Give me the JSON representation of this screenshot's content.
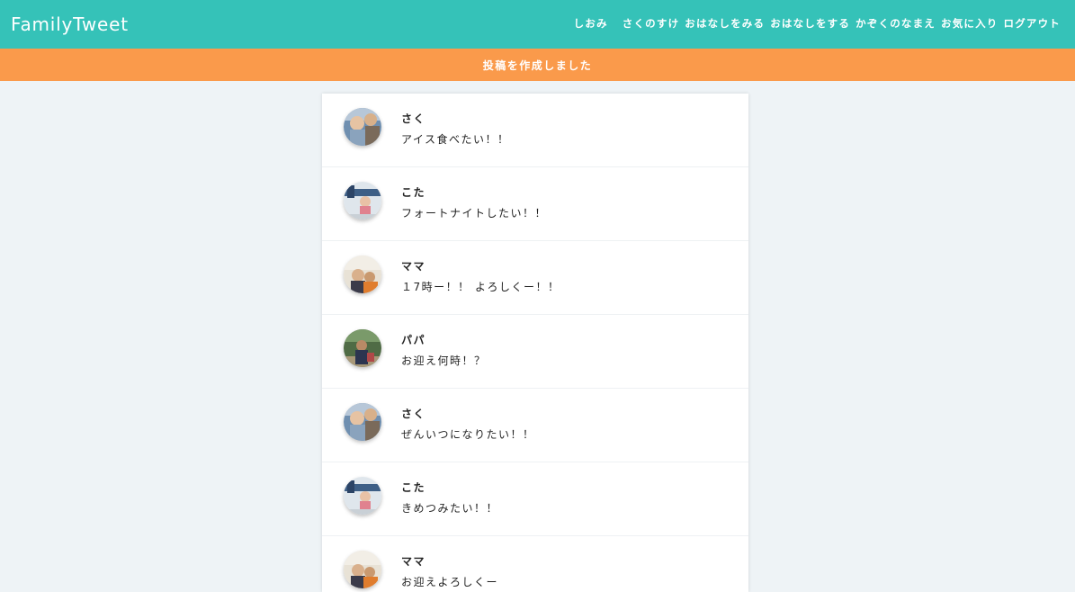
{
  "header": {
    "logo": "FamilyTweet",
    "nav": [
      "しおみ",
      "さくのすけ",
      "おはなしをみる",
      "おはなしをする",
      "かぞくのなまえ",
      "お気に入り",
      "ログアウト"
    ]
  },
  "flash": {
    "message": "投稿を作成しました"
  },
  "posts": [
    {
      "name": "さく",
      "text": "アイス食べたい！！",
      "avatar_icon": "photo-child-avatar-icon"
    },
    {
      "name": "こた",
      "text": "フォートナイトしたい！！",
      "avatar_icon": "photo-toddler-avatar-icon"
    },
    {
      "name": "ママ",
      "text": "１7時ー！！ よろしくー！！",
      "avatar_icon": "photo-mother-avatar-icon"
    },
    {
      "name": "パパ",
      "text": "お迎え何時！？",
      "avatar_icon": "photo-father-avatar-icon"
    },
    {
      "name": "さく",
      "text": "ぜんいつになりたい！！",
      "avatar_icon": "photo-child-avatar-icon"
    },
    {
      "name": "こた",
      "text": "きめつみたい！！",
      "avatar_icon": "photo-toddler-avatar-icon"
    },
    {
      "name": "ママ",
      "text": "お迎えよろしくー",
      "avatar_icon": "photo-mother-avatar-icon"
    }
  ],
  "colors": {
    "header": "#35c2b8",
    "flash": "#fa9a4b",
    "background": "#eef3f6"
  }
}
